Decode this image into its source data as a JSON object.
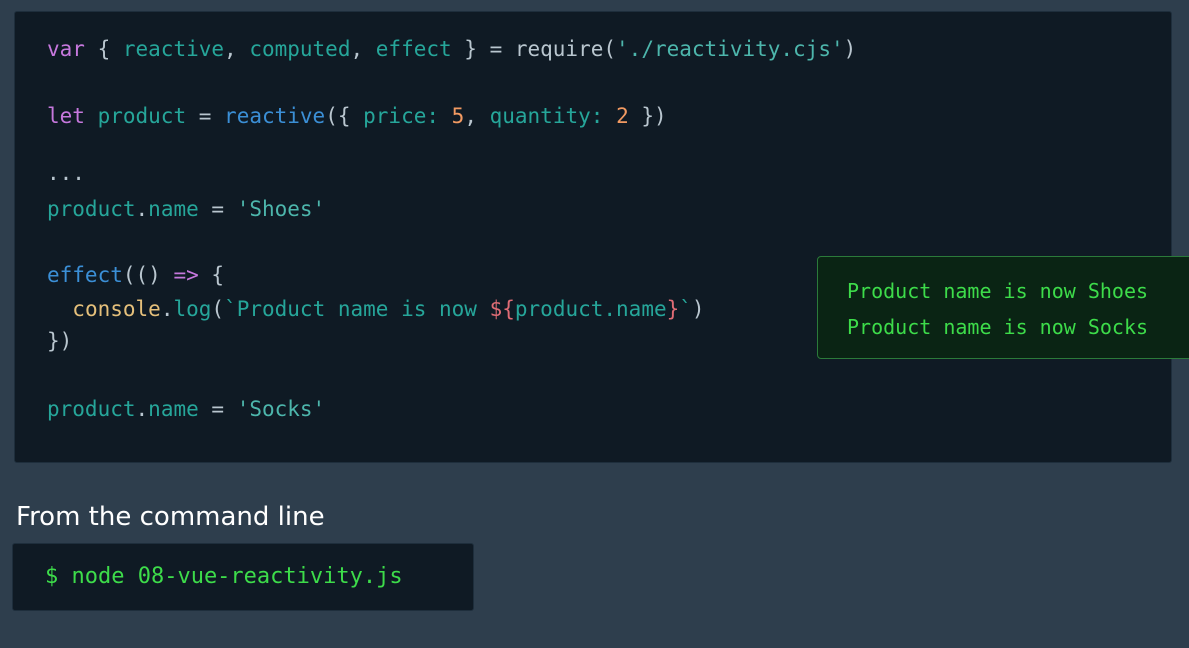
{
  "code": {
    "line1": {
      "kw": "var",
      "open": " { ",
      "id1": "reactive",
      "sep1": ", ",
      "id2": "computed",
      "sep2": ", ",
      "id3": "effect",
      "close": " } = ",
      "fn": "require",
      "paren_open": "(",
      "str": "'./reactivity.cjs'",
      "paren_close": ")"
    },
    "line2": {
      "kw": "let",
      "space": " ",
      "id": "product",
      "eq": " = ",
      "fn": "reactive",
      "open": "({ ",
      "key1": "price:",
      "space1": " ",
      "val1": "5",
      "sep": ", ",
      "key2": "quantity:",
      "space2": " ",
      "val2": "2",
      "close": " })"
    },
    "line3": "...",
    "line4": {
      "obj": "product",
      "dot": ".",
      "prop": "name",
      "eq": " = ",
      "str": "'Shoes'"
    },
    "line5": {
      "fn": "effect",
      "open": "(() ",
      "arrow": "=>",
      "brace": " {"
    },
    "line6": {
      "indent": "  ",
      "obj": "console",
      "dot": ".",
      "method": "log",
      "open": "(",
      "tick_open": "`",
      "text": "Product name is now ",
      "interp_open": "${",
      "expr": "product.name",
      "interp_close": "}",
      "tick_close": "`",
      "close": ")"
    },
    "line7": "})",
    "line8": {
      "obj": "product",
      "dot": ".",
      "prop": "name",
      "eq": " = ",
      "str": "'Socks'"
    }
  },
  "output": {
    "lines": [
      "Product name is now Shoes",
      "Product name is now Socks"
    ]
  },
  "section_label": "From the command line",
  "command": "$ node 08-vue-reactivity.js"
}
